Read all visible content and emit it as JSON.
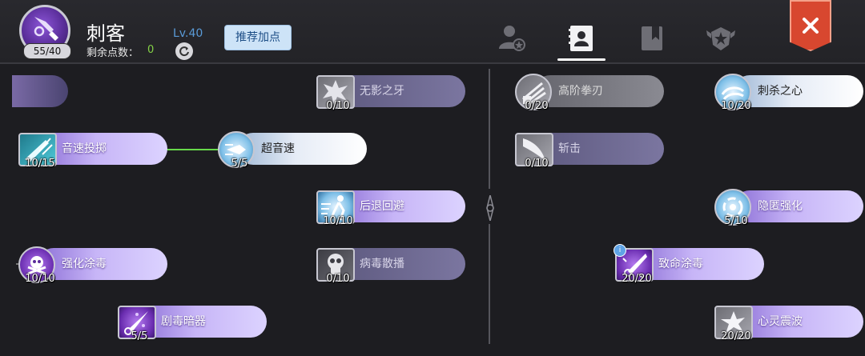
{
  "header": {
    "avatar_count": "55/40",
    "class_name": "刺客",
    "points_label": "剩余点数：",
    "points_value": "0",
    "level": "Lv.40",
    "recommend_label": "推荐加点",
    "tabs": [
      "character-star-icon",
      "skill-book-icon",
      "bookmark-icon",
      "emblem-icon"
    ],
    "active_tab": 1,
    "close_icon": "close-icon"
  },
  "skills": {
    "wuying": {
      "name": "无影之牙",
      "level": "0/10"
    },
    "yinsu": {
      "name": "音速投掷",
      "level": "10/15"
    },
    "chaoyinsu": {
      "name": "超音速",
      "level": "5/5"
    },
    "houtui": {
      "name": "后退回避",
      "level": "10/10"
    },
    "qianghua": {
      "name": "强化涂毒",
      "level": "10/10"
    },
    "bingdu": {
      "name": "病毒散播",
      "level": "0/10"
    },
    "judu": {
      "name": "剧毒暗器",
      "level": "5/5"
    },
    "gaojie": {
      "name": "高阶拳刃",
      "level": "0/20"
    },
    "cisha": {
      "name": "刺杀之心",
      "level": "10/20"
    },
    "zhanji": {
      "name": "斩击",
      "level": "0/10"
    },
    "yinni": {
      "name": "隐匿强化",
      "level": "5/10"
    },
    "zhiming": {
      "name": "致命涂毒",
      "level": "20/20",
      "badge": "i"
    },
    "xinling": {
      "name": "心灵震波",
      "level": "20/20"
    }
  },
  "colors": {
    "accent_green": "#67d94a",
    "skill_violet": "#c7b5f7",
    "close_red": "#d8472f"
  }
}
